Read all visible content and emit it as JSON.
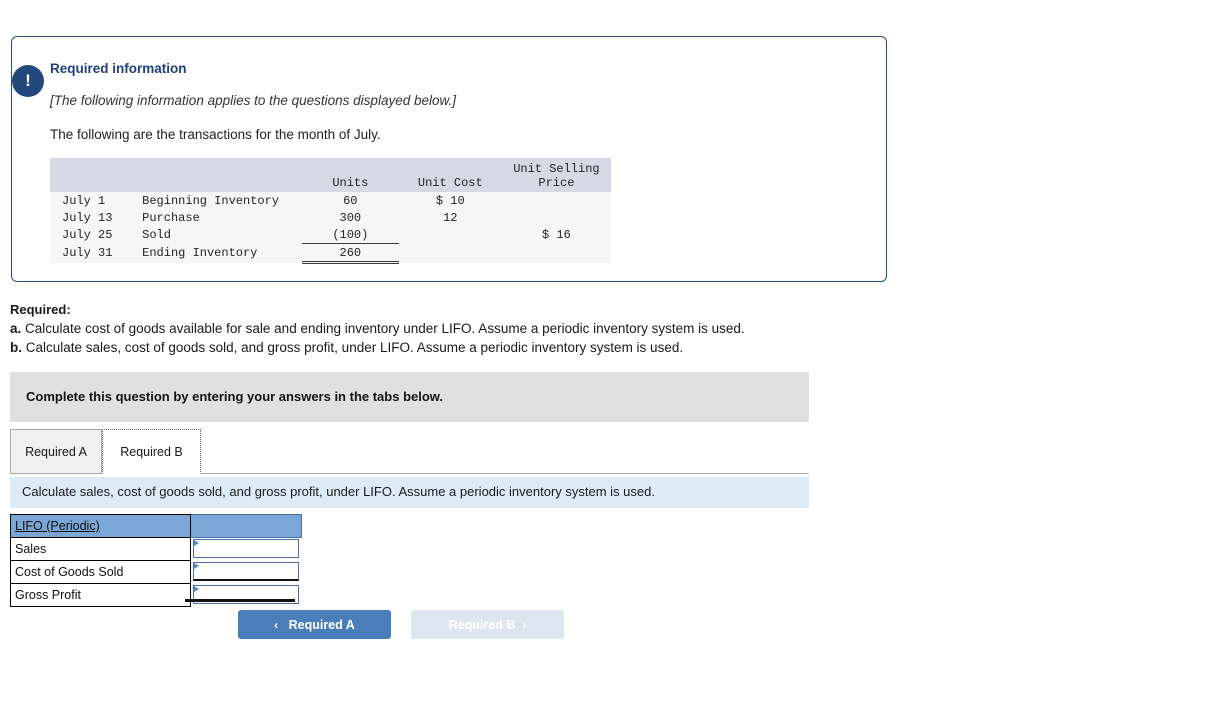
{
  "panel": {
    "badge_icon": "exclamation-icon",
    "badge_glyph": "!",
    "heading": "Required information",
    "note": "[The following information applies to the questions displayed below.]",
    "lead": "The following are the transactions for the month of July.",
    "border_color": "#2b4a7d",
    "heading_color": "#1f4079",
    "badge_color": "#24487c"
  },
  "transactions": {
    "headers": [
      "",
      "",
      "Units",
      "Unit Cost",
      "Unit Selling Price"
    ],
    "header_units": "Units",
    "header_unit_cost": "Unit Cost",
    "header_unit_selling_price_line1": "Unit Selling",
    "header_unit_selling_price_line2": "Price",
    "rows": [
      {
        "date": "July 1",
        "description": "Beginning Inventory",
        "units": "60",
        "unit_cost": "$ 10",
        "unit_selling_price": ""
      },
      {
        "date": "July 13",
        "description": "Purchase",
        "units": "300",
        "unit_cost": "12",
        "unit_selling_price": ""
      },
      {
        "date": "July 25",
        "description": "Sold",
        "units": "(100)",
        "unit_cost": "",
        "unit_selling_price": "$ 16"
      },
      {
        "date": "July 31",
        "description": "Ending Inventory",
        "units": "260",
        "unit_cost": "",
        "unit_selling_price": ""
      }
    ]
  },
  "required": {
    "label": "Required:",
    "items": [
      {
        "marker": "a.",
        "text": "Calculate cost of goods available for sale and ending inventory under LIFO. Assume a periodic inventory system is used."
      },
      {
        "marker": "b.",
        "text": "Calculate sales, cost of goods sold, and gross profit, under LIFO. Assume a periodic inventory system is used."
      }
    ]
  },
  "complete_bar": {
    "text": "Complete this question by entering your answers in the tabs below.",
    "background": "#e0e0e0"
  },
  "tabs": [
    {
      "label": "Required A",
      "active": false
    },
    {
      "label": "Required B",
      "active": true
    }
  ],
  "sub_instruction": {
    "text": "Calculate sales, cost of goods sold, and gross profit, under LIFO. Assume a periodic inventory system is used.",
    "background": "#ddebf7"
  },
  "answer_grid": {
    "header_label": "LIFO (Periodic)",
    "header_value": "",
    "header_background": "#7ba7d7",
    "rows": [
      {
        "label": "Sales",
        "value": ""
      },
      {
        "label": "Cost of Goods Sold",
        "value": ""
      },
      {
        "label": "Gross Profit",
        "value": ""
      }
    ]
  },
  "nav": {
    "prev": {
      "label": "Required A",
      "chevron": "‹",
      "enabled": true,
      "color": "#4a7ebb"
    },
    "next": {
      "label": "Required B",
      "chevron": "›",
      "enabled": false,
      "color": "#dde5ef"
    }
  }
}
